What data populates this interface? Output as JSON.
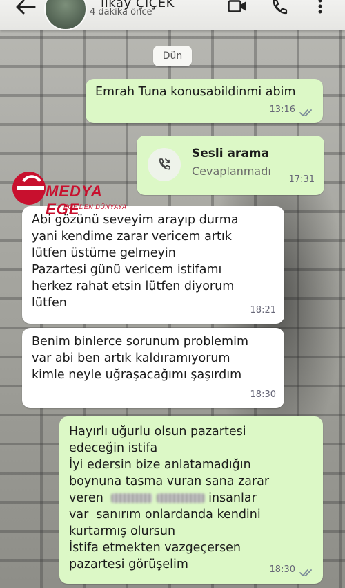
{
  "header": {
    "contact_name": "İlkay ÇİÇEK",
    "last_seen": "4 dakika önce",
    "icons": [
      "back-arrow-icon",
      "video-call-icon",
      "phone-icon",
      "more-vert-icon"
    ]
  },
  "chat": {
    "day_chip": "Dün",
    "messages": [
      {
        "direction": "out",
        "text": "Emrah Tuna konusabildinmi abim",
        "time": "13:16",
        "read": true
      },
      {
        "direction": "out",
        "type": "call",
        "title": "Sesli arama",
        "status": "Cevaplanmadı",
        "time": "17:31"
      },
      {
        "direction": "in",
        "text": "Abi gözünü seveyim arayıp durma\nyani kendime zarar vericem artık\nlütfen üstüme gelmeyin\nPazartesi günü vericem istifamı\nherkez rahat etsin lütfen diyorum\nlütfen",
        "time": "18:21"
      },
      {
        "direction": "in",
        "text": "Benim binlerce sorunum problemim\nvar abi ben artık kaldıramıyorum\nkimle neyle uğraşacağımı şaşırdım",
        "time": "18:30"
      },
      {
        "direction": "out",
        "lines": [
          "Hayırlı uğurlu olsun pazartesi",
          "edeceğin istifa",
          "İyi edersin bize anlatamadığın",
          "boynuna tasma vuran sana zarar",
          "insanlar",
          "var  sanırım onlardanda kendini",
          "kurtarmış olursun",
          "İstifa etmekten vazgeçersen",
          "pazartesi görüşelim"
        ],
        "blurred_line_prefix": "veren",
        "time": "18:30",
        "read": true
      }
    ]
  },
  "watermark": {
    "brand": "MEDYA EGE",
    "tagline": "EGE'DEN DÜNYAYA"
  },
  "colors": {
    "outgoing_bubble": "#dcf8c6",
    "incoming_bubble": "#ffffff",
    "read_ticks": "#7a8a99",
    "logo_red": "#c8102e"
  }
}
